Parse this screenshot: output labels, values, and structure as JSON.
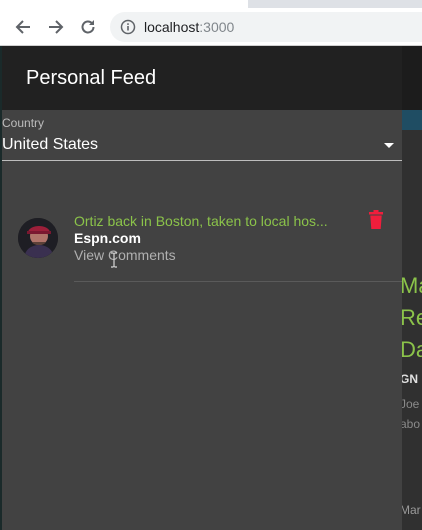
{
  "browser": {
    "url_host": "localhost",
    "url_port": ":3000"
  },
  "background": {
    "title": "Ma\nRe\nDa",
    "source": "GN",
    "meta_line1": "Joe",
    "meta_line2": "abo",
    "bottom_text": "Mar"
  },
  "drawer": {
    "title": "Personal Feed",
    "country_label": "Country",
    "country_value": "United States"
  },
  "feed": {
    "items": [
      {
        "title": "Ortiz back in Boston, taken to local hos...",
        "source": "Espn.com",
        "comments_link": "View Comments"
      }
    ]
  },
  "colors": {
    "accent_green": "#8bc34a",
    "delete_red": "#f01e3c",
    "drawer_bg": "#424242",
    "appbar_bg": "#212121"
  },
  "icons": {
    "back": "arrow-left-icon",
    "forward": "arrow-right-icon",
    "reload": "reload-icon",
    "site_info": "info-icon",
    "delete": "trash-icon",
    "dropdown": "caret-down-icon"
  }
}
